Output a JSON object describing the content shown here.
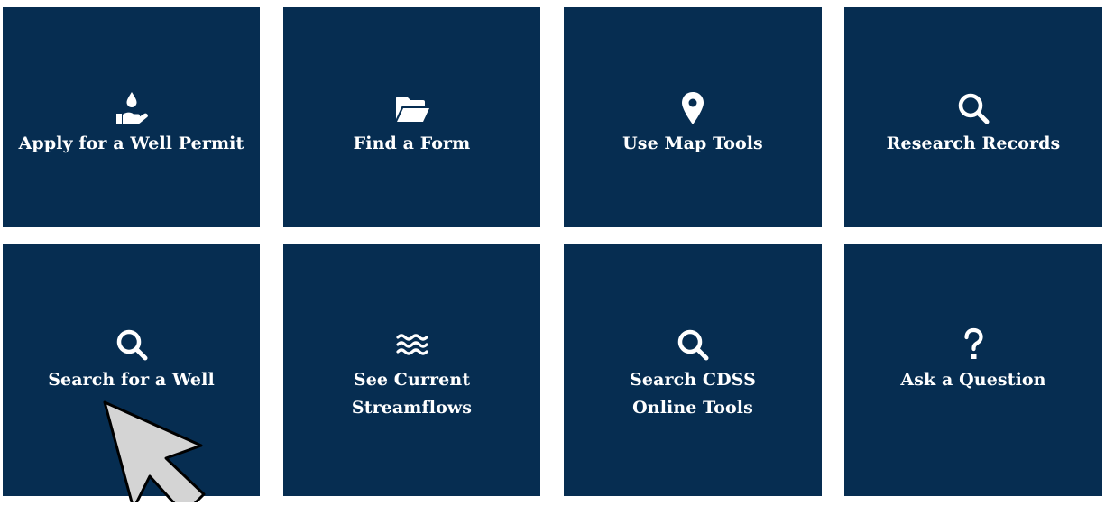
{
  "tiles": [
    {
      "label": "Apply for a Well Permit",
      "icon": "hand-water-drop-icon"
    },
    {
      "label": "Find a Form",
      "icon": "folder-open-icon"
    },
    {
      "label": "Use Map Tools",
      "icon": "map-marker-icon"
    },
    {
      "label": "Research Records",
      "icon": "search-icon"
    },
    {
      "label": "Search for a Well",
      "icon": "search-icon"
    },
    {
      "label": "See Current Streamflows",
      "icon": "water-waves-icon"
    },
    {
      "label": "Search CDSS Online Tools",
      "icon": "search-icon"
    },
    {
      "label": "Ask a Question",
      "icon": "question-mark-icon"
    }
  ],
  "colors": {
    "tile_background": "#062d51",
    "tile_text": "#ffffff",
    "page_background": "#ffffff"
  },
  "cursor": {
    "icon": "mouse-pointer-arrow-icon"
  }
}
